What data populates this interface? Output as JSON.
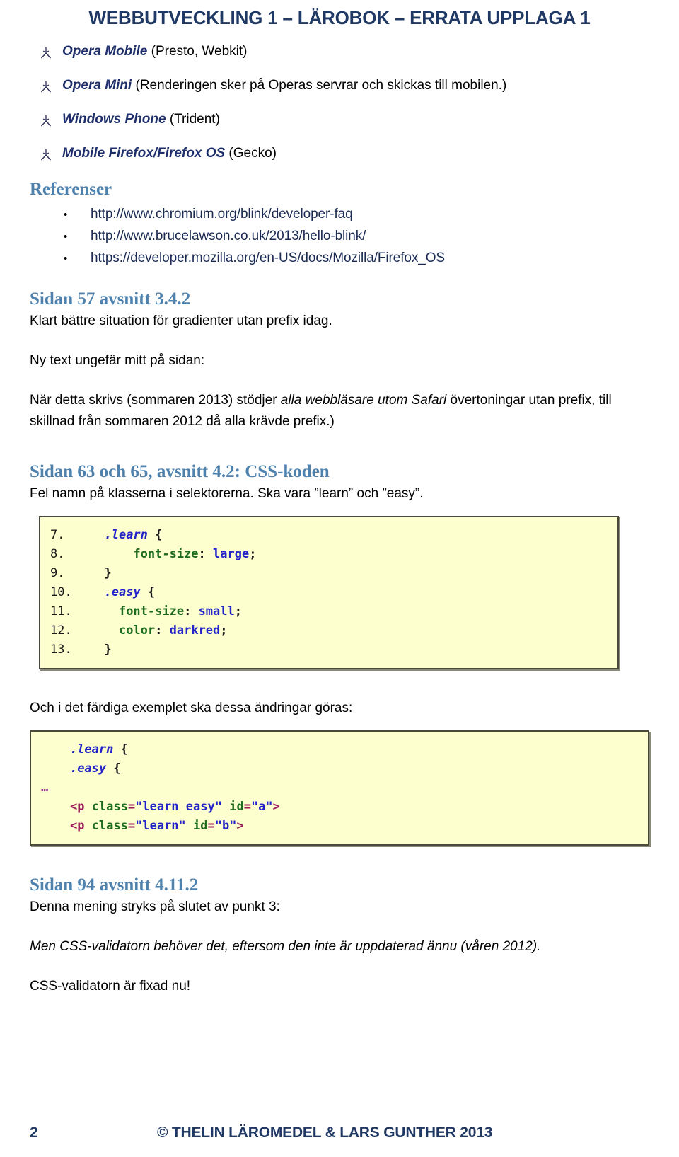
{
  "document": {
    "title": "WEBBUTVECKLING 1 – LÄROBOK – ERRATA UPPLAGA 1",
    "title_color": "#1f3864",
    "heading_color": "#4f81ad",
    "code_bg_color": "#feffcf",
    "code_border_color": "#4a4a3a"
  },
  "browser_list": {
    "bullet_icon": "wingdings-tripod-bullet",
    "items": [
      {
        "name": "Opera Mobile",
        "detail": " (Presto, Webkit)"
      },
      {
        "name": "Opera Mini",
        "detail": " (Renderingen sker på Operas servrar och skickas till mobilen.)"
      },
      {
        "name": "Windows Phone",
        "detail": " (Trident)"
      },
      {
        "name": "Mobile Firefox/Firefox OS",
        "detail": " (Gecko)"
      }
    ]
  },
  "references": {
    "heading": "Referenser",
    "bullet_glyph": "•",
    "urls": [
      "http://www.chromium.org/blink/developer-faq",
      "http://www.brucelawson.co.uk/2013/hello-blink/",
      "https://developer.mozilla.org/en-US/docs/Mozilla/Firefox_OS"
    ]
  },
  "section_57": {
    "heading": "Sidan 57 avsnitt 3.4.2",
    "line1": "Klart bättre situation för gradienter utan prefix idag.",
    "line2": "Ny text ungefär mitt på sidan:",
    "para_part1": "När detta skrivs (sommaren 2013) stödjer ",
    "para_italic": "alla webbläsare utom Safari",
    "para_part2": " övertoningar utan prefix, till skillnad från sommaren 2012 då alla krävde prefix.)"
  },
  "section_63_65": {
    "heading": "Sidan 63 och 65, avsnitt 4.2: CSS-koden",
    "intro": "Fel namn på klasserna i selektorerna. Ska vara ”learn” och ”easy”.",
    "code_css": {
      "lines": [
        {
          "num": "7.",
          "indent": "  ",
          "tokens": [
            {
              "t": ".learn",
              "c": "c-sel"
            },
            {
              "t": " {",
              "c": "c-punct"
            }
          ]
        },
        {
          "num": "8.",
          "indent": "      ",
          "tokens": [
            {
              "t": "font-size",
              "c": "c-prop"
            },
            {
              "t": ": ",
              "c": "c-punct"
            },
            {
              "t": "large",
              "c": "c-val"
            },
            {
              "t": ";",
              "c": "c-punct"
            }
          ]
        },
        {
          "num": "9.",
          "indent": "  ",
          "tokens": [
            {
              "t": "}",
              "c": "c-punct"
            }
          ]
        },
        {
          "num": "10.",
          "indent": "  ",
          "tokens": [
            {
              "t": ".easy",
              "c": "c-sel"
            },
            {
              "t": " {",
              "c": "c-punct"
            }
          ]
        },
        {
          "num": "11.",
          "indent": "    ",
          "tokens": [
            {
              "t": "font-size",
              "c": "c-prop"
            },
            {
              "t": ": ",
              "c": "c-punct"
            },
            {
              "t": "small",
              "c": "c-val"
            },
            {
              "t": ";",
              "c": "c-punct"
            }
          ]
        },
        {
          "num": "12.",
          "indent": "    ",
          "tokens": [
            {
              "t": "color",
              "c": "c-prop"
            },
            {
              "t": ": ",
              "c": "c-punct"
            },
            {
              "t": "darkred",
              "c": "c-val"
            },
            {
              "t": ";",
              "c": "c-punct"
            }
          ]
        },
        {
          "num": "13.",
          "indent": "  ",
          "tokens": [
            {
              "t": "}",
              "c": "c-punct"
            }
          ]
        }
      ]
    },
    "after_code": "Och i det färdiga exemplet ska dessa ändringar göras:",
    "code_html": {
      "lines": [
        {
          "num": "",
          "indent": "    ",
          "tokens": [
            {
              "t": ".learn",
              "c": "c-sel"
            },
            {
              "t": " {",
              "c": "c-punct"
            }
          ]
        },
        {
          "num": "",
          "indent": "    ",
          "tokens": [
            {
              "t": ".easy",
              "c": "c-sel"
            },
            {
              "t": " {",
              "c": "c-punct"
            }
          ]
        },
        {
          "num": "",
          "indent": "",
          "tokens": [
            {
              "t": "…",
              "c": "c-ell"
            }
          ]
        },
        {
          "num": "",
          "indent": "    ",
          "tokens": [
            {
              "t": "<p",
              "c": "c-tag"
            },
            {
              "t": " ",
              "c": "c-punct"
            },
            {
              "t": "class",
              "c": "c-attr"
            },
            {
              "t": "=",
              "c": "c-tag"
            },
            {
              "t": "\"learn easy\"",
              "c": "c-str"
            },
            {
              "t": " ",
              "c": "c-punct"
            },
            {
              "t": "id",
              "c": "c-attr"
            },
            {
              "t": "=",
              "c": "c-tag"
            },
            {
              "t": "\"a\"",
              "c": "c-str"
            },
            {
              "t": ">",
              "c": "c-tag"
            }
          ]
        },
        {
          "num": "",
          "indent": "    ",
          "tokens": [
            {
              "t": "<p",
              "c": "c-tag"
            },
            {
              "t": " ",
              "c": "c-punct"
            },
            {
              "t": "class",
              "c": "c-attr"
            },
            {
              "t": "=",
              "c": "c-tag"
            },
            {
              "t": "\"learn\"",
              "c": "c-str"
            },
            {
              "t": " ",
              "c": "c-punct"
            },
            {
              "t": "id",
              "c": "c-attr"
            },
            {
              "t": "=",
              "c": "c-tag"
            },
            {
              "t": "\"b\"",
              "c": "c-str"
            },
            {
              "t": ">",
              "c": "c-tag"
            }
          ]
        }
      ]
    }
  },
  "section_94": {
    "heading": "Sidan 94 avsnitt 4.11.2",
    "line1": "Denna mening stryks på slutet av punkt 3:",
    "line2_italic": "Men CSS-validatorn behöver det, eftersom den inte är uppdaterad ännu (våren 2012).",
    "line3": "CSS-validatorn är fixad nu!"
  },
  "footer": {
    "page_number": "2",
    "copyright": "© THELIN LÄROMEDEL & LARS GUNTHER 2013"
  }
}
